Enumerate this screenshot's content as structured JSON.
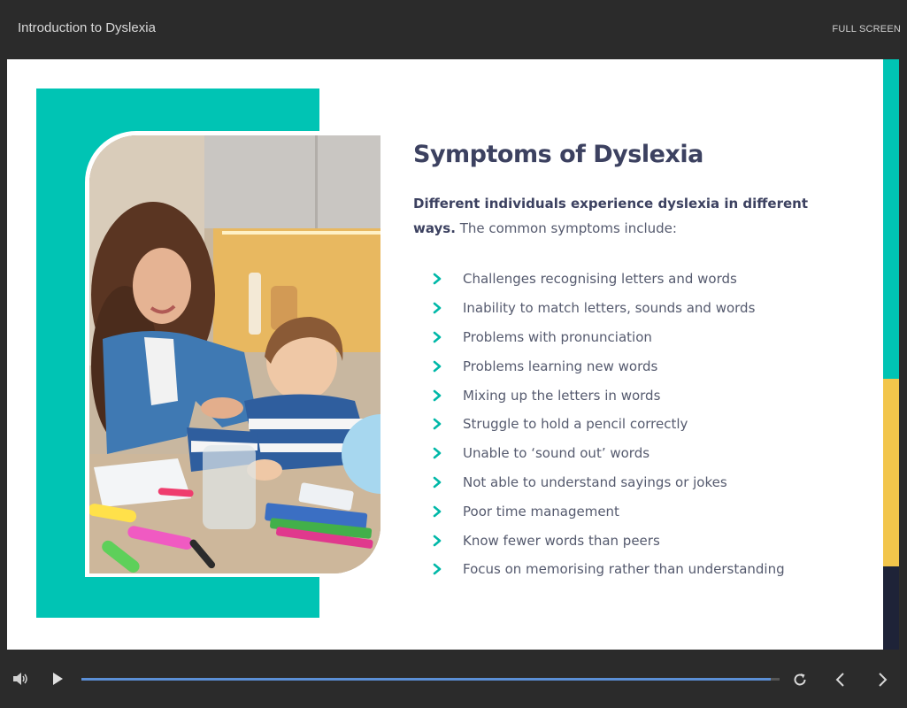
{
  "header": {
    "title": "Introduction to Dyslexia",
    "fullscreen_label": "FULL SCREEN"
  },
  "slide": {
    "heading": "Symptoms of Dyslexia",
    "intro_bold": "Different individuals experience dyslexia in different ways.",
    "intro_rest": " The common symptoms include:",
    "symptoms": [
      "Challenges recognising letters and words",
      "Inability to match letters, sounds and words",
      "Problems with pronunciation",
      "Problems learning new words",
      "Mixing up the letters in words",
      "Struggle to hold a pencil correctly",
      "Unable to ‘sound out’ words",
      "Not able to understand sayings or jokes",
      "Poor time management",
      "Know fewer words than peers",
      "Focus on memorising rather than understanding"
    ],
    "image_alt": "Mother and child at a kitchen table"
  },
  "player": {
    "progress": 0.987
  },
  "icons": {
    "volume": "volume-icon",
    "play": "play-icon",
    "replay": "replay-icon",
    "prev": "chevron-left-icon",
    "next": "chevron-right-icon",
    "bullet": "chevron-right-icon"
  },
  "colors": {
    "teal": "#00c4b4",
    "yellow": "#f2c54b",
    "navy": "#1e2338",
    "heading": "#3c4160",
    "progress": "#5b8fd6"
  }
}
